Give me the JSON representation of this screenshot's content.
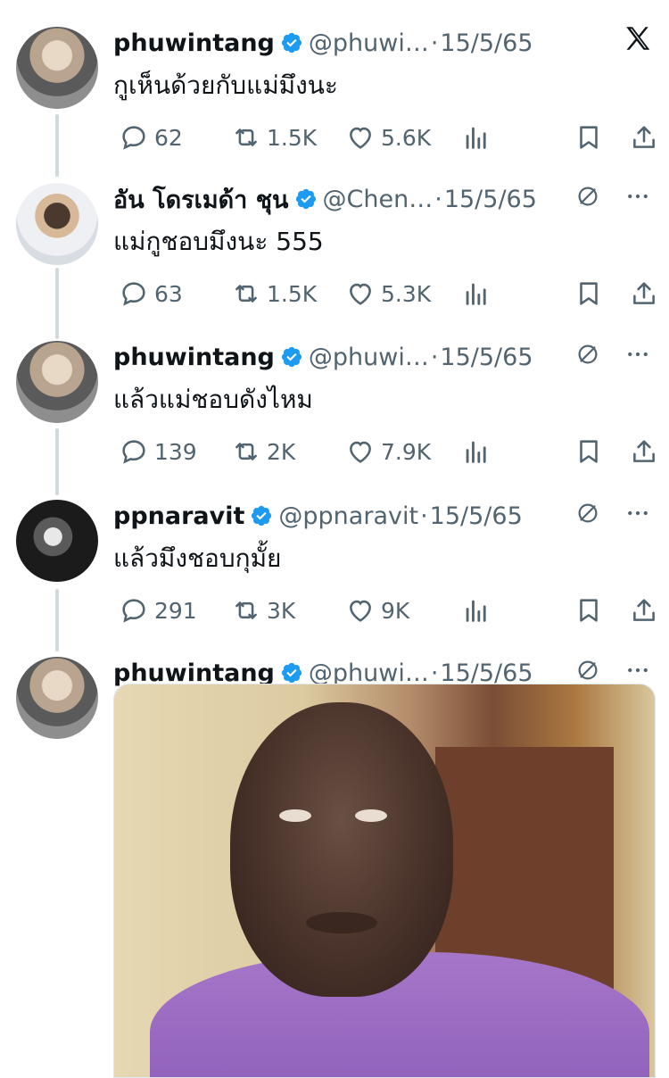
{
  "close_icon": "x-logo-icon",
  "tweets": [
    {
      "name": "phuwintang",
      "handle": "@phuwi…",
      "date": "15/5/65",
      "text": "กูเห็นด้วยกับแม่มึงนะ",
      "replies": "62",
      "retweets": "1.5K",
      "likes": "5.6K",
      "avatar": "avatar-phuwintang"
    },
    {
      "name": "อัน โดรเมด้า ชุน",
      "handle": "@Chen…",
      "date": "15/5/65",
      "text": "แม่กูชอบมึงนะ 555",
      "replies": "63",
      "retweets": "1.5K",
      "likes": "5.3K",
      "avatar": "avatar-chen"
    },
    {
      "name": "phuwintang",
      "handle": "@phuwi…",
      "date": "15/5/65",
      "text": "แล้วแม่ชอบดังไหม",
      "replies": "139",
      "retweets": "2K",
      "likes": "7.9K",
      "avatar": "avatar-phuwintang"
    },
    {
      "name": "ppnaravit",
      "handle": "@ppnaravit",
      "date": "15/5/65",
      "text": "แล้วมึงชอบกุมั้ย",
      "replies": "291",
      "retweets": "3K",
      "likes": "9K",
      "avatar": "avatar-ppnaravit"
    },
    {
      "name": "phuwintang",
      "handle": "@phuwi…",
      "date": "15/5/65",
      "media": "meme-image",
      "avatar": "avatar-phuwintang"
    }
  ]
}
